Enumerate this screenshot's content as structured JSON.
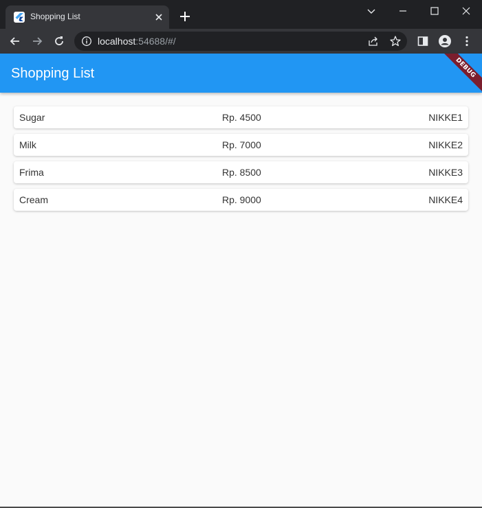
{
  "browser": {
    "tab_title": "Shopping List",
    "url_host": "localhost",
    "url_rest": ":54688/#/"
  },
  "app": {
    "title": "Shopping List",
    "debug_banner": "DEBUG",
    "primary_color": "#2196f3"
  },
  "items": [
    {
      "name": "Sugar",
      "price": "Rp. 4500",
      "code": "NIKKE1"
    },
    {
      "name": "Milk",
      "price": "Rp. 7000",
      "code": "NIKKE2"
    },
    {
      "name": "Frima",
      "price": "Rp. 8500",
      "code": "NIKKE3"
    },
    {
      "name": "Cream",
      "price": "Rp. 9000",
      "code": "NIKKE4"
    }
  ]
}
